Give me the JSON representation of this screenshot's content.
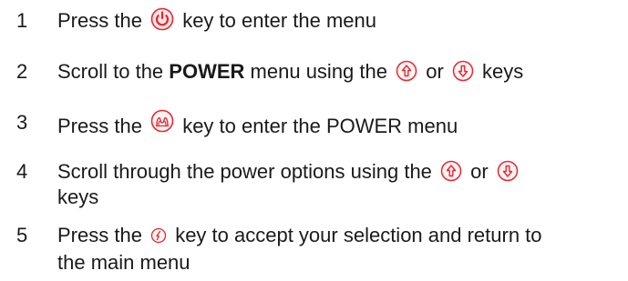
{
  "steps": [
    {
      "number": "1",
      "before": "Press the",
      "icon": "power-icon",
      "after": "key to enter the menu"
    },
    {
      "number": "2",
      "before": "Scroll to the",
      "bold": "POWER",
      "middle": "menu using the",
      "icon_a": "up-arrow-icon",
      "or": "or",
      "icon_b": "down-arrow-icon",
      "after": "keys"
    },
    {
      "number": "3",
      "before": "Press the",
      "icon": "menu-enter-icon",
      "after": "key to enter the POWER menu"
    },
    {
      "number": "4",
      "before": "Scroll through the power options using the",
      "icon_a": "up-arrow-icon",
      "or": "or",
      "icon_b": "down-arrow-icon",
      "after": "keys"
    },
    {
      "number": "5",
      "before": "Press the",
      "icon": "accept-icon",
      "after": "key to accept your selection and return to the main menu"
    }
  ],
  "colors": {
    "icon_red": "#e8262f",
    "text": "#1a1a1a"
  }
}
